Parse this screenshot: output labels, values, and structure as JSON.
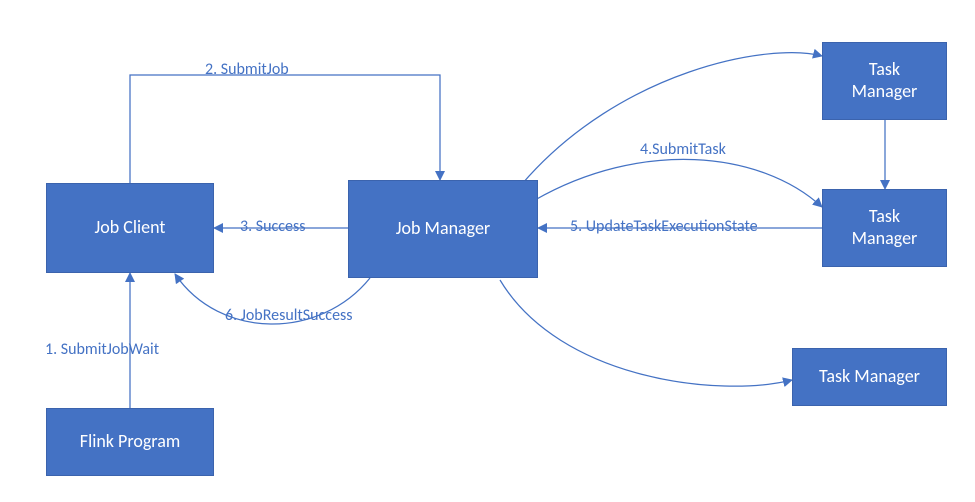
{
  "nodes": {
    "flink_program": {
      "label": "Flink Program"
    },
    "job_client": {
      "label": "Job Client"
    },
    "job_manager": {
      "label": "Job Manager"
    },
    "task_manager_1": {
      "label": "Task\nManager"
    },
    "task_manager_2": {
      "label": "Task\nManager"
    },
    "task_manager_3": {
      "label": "Task Manager"
    }
  },
  "edges": {
    "e1": {
      "label": "1. SubmitJobWait"
    },
    "e2": {
      "label": "2. SubmitJob"
    },
    "e3": {
      "label": "3. Success"
    },
    "e4": {
      "label": "4.SubmitTask"
    },
    "e5": {
      "label": "5. UpdateTaskExecutionState"
    },
    "e6": {
      "label": "6. JobResultSuccess"
    }
  },
  "colors": {
    "box_fill": "#4472c4",
    "edge": "#4472c4",
    "text_on_box": "#ffffff",
    "label": "#4472c4"
  }
}
